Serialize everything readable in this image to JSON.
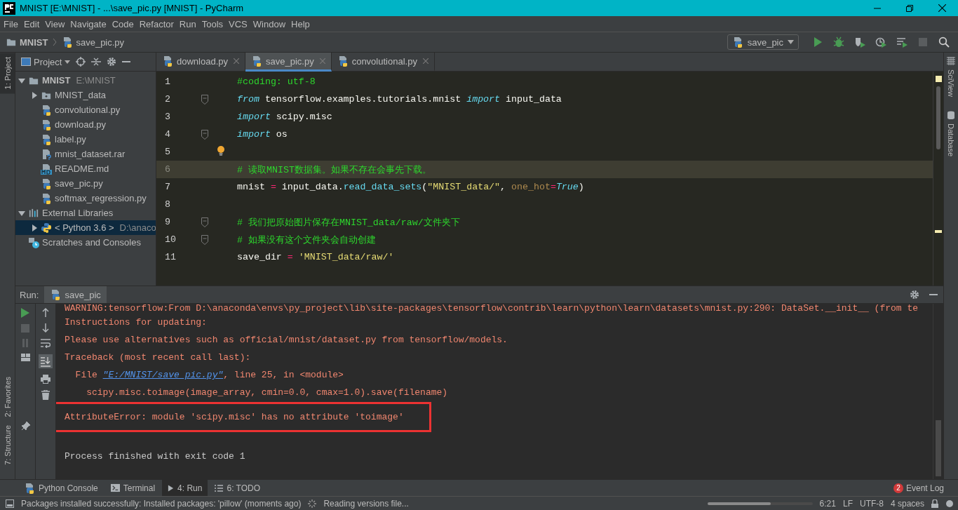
{
  "window": {
    "title": "MNIST [E:\\MNIST] - ...\\save_pic.py [MNIST] - PyCharm"
  },
  "menu": [
    "File",
    "Edit",
    "View",
    "Navigate",
    "Code",
    "Refactor",
    "Run",
    "Tools",
    "VCS",
    "Window",
    "Help"
  ],
  "breadcrumb": [
    {
      "kind": "folder",
      "label": "MNIST"
    },
    {
      "kind": "python",
      "label": "save_pic.py"
    }
  ],
  "run_config": "save_pic",
  "left_strip": {
    "top": [
      {
        "label": "1: Project",
        "selected": true
      }
    ],
    "bottom": [
      {
        "label": "2: Favorites",
        "selected": false
      },
      {
        "label": "7: Structure",
        "selected": false
      }
    ]
  },
  "right_strip": [
    "SciView",
    "Database"
  ],
  "project_panel": {
    "title": "Project",
    "tree": [
      {
        "kind": "module",
        "label": "MNIST",
        "path": "E:\\MNIST",
        "expanded": true,
        "selected": false,
        "children": [
          {
            "kind": "folder",
            "label": "MNIST_data",
            "expanded": false,
            "selected": false
          },
          {
            "kind": "python",
            "label": "convolutional.py",
            "selected": false
          },
          {
            "kind": "python",
            "label": "download.py",
            "selected": false
          },
          {
            "kind": "python",
            "label": "label.py",
            "selected": false
          },
          {
            "kind": "unknown",
            "label": "mnist_dataset.rar",
            "selected": false
          },
          {
            "kind": "markdown",
            "label": "README.md",
            "selected": false
          },
          {
            "kind": "python",
            "label": "save_pic.py",
            "selected": false
          },
          {
            "kind": "python",
            "label": "softmax_regression.py",
            "selected": false
          }
        ]
      },
      {
        "kind": "library",
        "label": "External Libraries",
        "expanded": true,
        "selected": false,
        "children": [
          {
            "kind": "sdk",
            "label": "< Python 3.6 >",
            "path": "D:\\anaco",
            "expanded": false,
            "selected": true
          }
        ]
      },
      {
        "kind": "scratches",
        "label": "Scratches and Consoles",
        "selected": false
      }
    ]
  },
  "editor_tabs": [
    {
      "label": "download.py",
      "selected": false
    },
    {
      "label": "save_pic.py",
      "selected": true
    },
    {
      "label": "convolutional.py",
      "selected": false
    }
  ],
  "code": [
    {
      "number": "1",
      "tokens": [
        {
          "kind": "comment",
          "text": "#coding: utf-8"
        }
      ]
    },
    {
      "number": "2",
      "fold": true,
      "tokens": [
        {
          "kind": "keyword",
          "text": "from"
        },
        {
          "kind": "plain",
          "text": " tensorflow.examples.tutorials.mnist "
        },
        {
          "kind": "keyword",
          "text": "import"
        },
        {
          "kind": "plain",
          "text": " input_data"
        }
      ]
    },
    {
      "number": "3",
      "tokens": [
        {
          "kind": "keyword",
          "text": "import"
        },
        {
          "kind": "plain",
          "text": " scipy.misc"
        }
      ]
    },
    {
      "number": "4",
      "fold": true,
      "tokens": [
        {
          "kind": "keyword",
          "text": "import"
        },
        {
          "kind": "plain",
          "text": " os"
        }
      ]
    },
    {
      "number": "5",
      "bulb": true
    },
    {
      "number": "6",
      "current": true,
      "tokens": [
        {
          "kind": "comment",
          "text": "# 读取MNIST数据集。如果不存在会事先下载。"
        }
      ]
    },
    {
      "number": "7",
      "tokens": [
        {
          "kind": "plain",
          "text": "mnist "
        },
        {
          "kind": "operator",
          "text": "="
        },
        {
          "kind": "plain",
          "text": " input_data."
        },
        {
          "kind": "function",
          "text": "read_data_sets"
        },
        {
          "kind": "plain",
          "text": "("
        },
        {
          "kind": "string",
          "text": "\"MNIST_data/\""
        },
        {
          "kind": "plain",
          "text": ", "
        },
        {
          "kind": "param",
          "text": "one_hot"
        },
        {
          "kind": "operator",
          "text": "="
        },
        {
          "kind": "keyword",
          "text": "True"
        },
        {
          "kind": "plain",
          "text": ")"
        }
      ]
    },
    {
      "number": "8"
    },
    {
      "number": "9",
      "fold": true,
      "tokens": [
        {
          "kind": "comment",
          "text": "# 我们把原始图片保存在MNIST_data/raw/文件夹下"
        }
      ]
    },
    {
      "number": "10",
      "fold": true,
      "tokens": [
        {
          "kind": "comment",
          "text": "# 如果没有这个文件夹会自动创建"
        }
      ]
    },
    {
      "number": "11",
      "tokens": [
        {
          "kind": "plain",
          "text": "save_dir "
        },
        {
          "kind": "operator",
          "text": "="
        },
        {
          "kind": "string",
          "text": " 'MNIST_data/raw/'"
        }
      ]
    }
  ],
  "run_panel": {
    "label": "Run:",
    "tab": "save_pic",
    "console": [
      {
        "tokens": [
          {
            "kind": "error",
            "text": "WARNING:tensorflow:From D:\\anaconda\\envs\\py_project\\lib\\site-packages\\tensorflow\\contrib\\learn\\python\\learn\\datasets\\mnist.py:290: DataSet.__init__ (from te"
          }
        ]
      },
      {
        "tokens": [
          {
            "kind": "error",
            "text": "Instructions for updating:"
          }
        ]
      },
      {
        "tokens": [
          {
            "kind": "error",
            "text": "Please use alternatives such as official/mnist/dataset.py from tensorflow/models."
          }
        ]
      },
      {
        "tokens": [
          {
            "kind": "error",
            "text": "Traceback (most recent call last):"
          }
        ]
      },
      {
        "tokens": [
          {
            "kind": "error",
            "text": "  File "
          },
          {
            "kind": "link",
            "text": "\"E:/MNIST/save_pic.py\""
          },
          {
            "kind": "error",
            "text": ", line 25, in <module>"
          }
        ]
      },
      {
        "tokens": [
          {
            "kind": "error",
            "text": "    scipy.misc.toimage(image_array, cmin=0.0, cmax=1.0).save(filename)"
          }
        ]
      },
      {
        "boxed": true,
        "tokens": [
          {
            "kind": "error",
            "text": "AttributeError: module 'scipy.misc' has no attribute 'toimage'"
          }
        ]
      },
      {
        "tokens": [
          {
            "kind": "output",
            "text": "Process finished with exit code 1"
          }
        ]
      }
    ]
  },
  "tool_tabs": [
    {
      "kind": "console",
      "label": "Python Console",
      "selected": false
    },
    {
      "kind": "terminal",
      "label": "Terminal",
      "selected": false
    },
    {
      "kind": "run",
      "label": "4: Run",
      "selected": true
    },
    {
      "kind": "todo",
      "label": "6: TODO",
      "selected": false
    }
  ],
  "event_log": {
    "label": "Event Log",
    "count": "2"
  },
  "status_bar": {
    "message": "Packages installed successfully: Installed packages: 'pillow' (moments ago)",
    "task": "Reading versions file...",
    "progress": {
      "level": 0.6
    },
    "position": "6:21",
    "line_separator": "LF",
    "encoding": "UTF-8",
    "indent": "4 spaces"
  }
}
